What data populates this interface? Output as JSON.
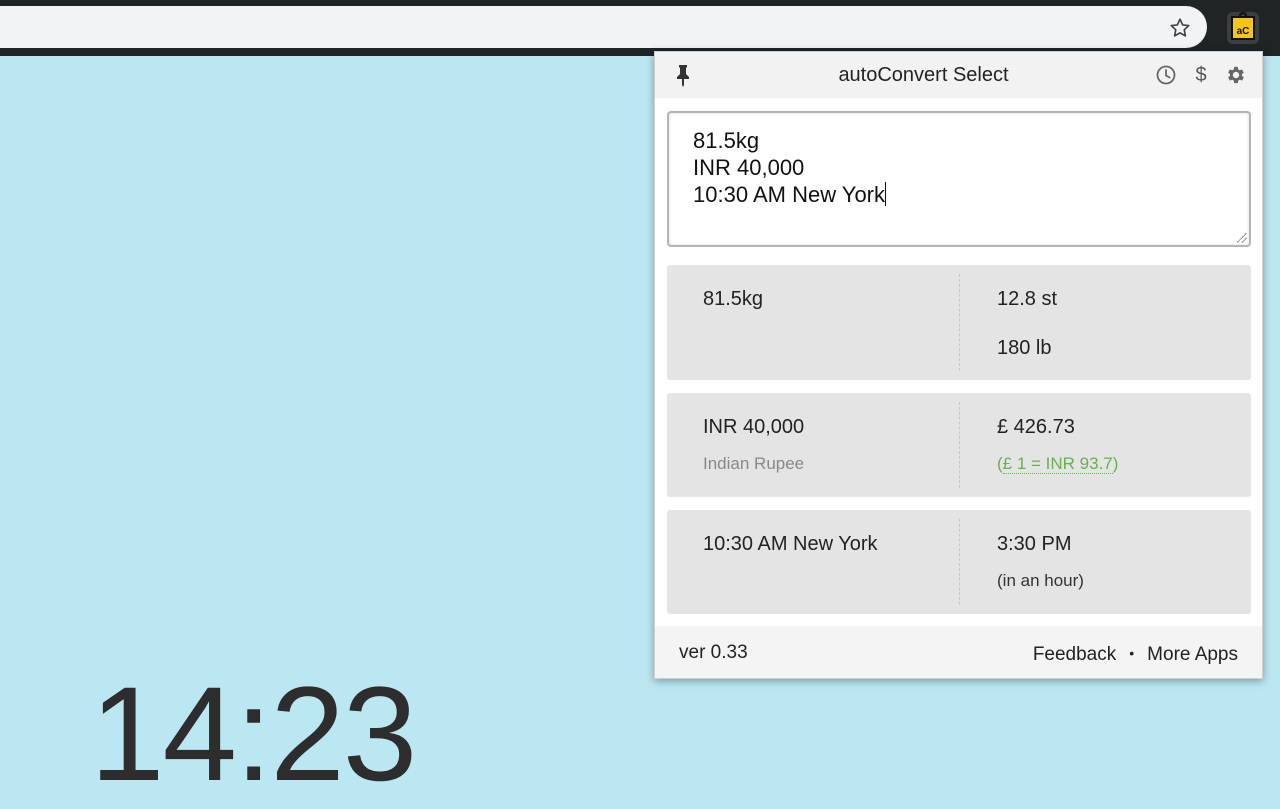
{
  "browser": {
    "bookmark_icon": "star-outline-icon",
    "extension_icon": "autoconvert-logo-icon",
    "extension_logo_text": "aC"
  },
  "clock": {
    "time": "14:23"
  },
  "popup": {
    "title": "autoConvert Select",
    "header_icons": [
      "pin-icon",
      "history-clock-icon",
      "currency-dollar-icon",
      "settings-gear-icon"
    ],
    "dollar_symbol": "$",
    "input_lines": [
      "81.5kg",
      "INR 40,000",
      "10:30 AM New York"
    ],
    "results": [
      {
        "source": "81.5kg",
        "outputs": [
          "12.8 st",
          "180 lb"
        ]
      },
      {
        "source": "INR 40,000",
        "source_sub": "Indian Rupee",
        "output": "£ 426.73",
        "rate_open": "(",
        "rate": "£ 1 = INR 93.7",
        "rate_close": ")"
      },
      {
        "source": "10:30 AM New York",
        "output": "3:30 PM",
        "note": "(in an hour)"
      }
    ],
    "footer": {
      "version": "ver 0.33",
      "feedback": "Feedback",
      "separator": "•",
      "more_apps": "More Apps"
    }
  },
  "colors": {
    "page_background": "#bbe7f3",
    "rate_green": "#6ab04c",
    "card_gray": "#e4e4e4"
  }
}
